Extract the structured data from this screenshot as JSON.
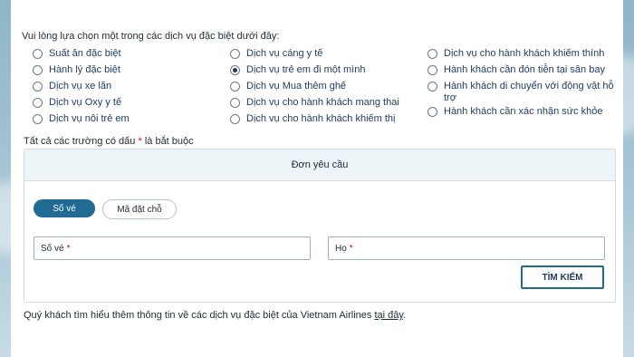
{
  "intro": "Vui lòng lựa chọn một trong các dịch vụ đặc biệt dưới đây:",
  "services": {
    "col1": [
      {
        "label": "Suất ăn đặc biệt",
        "selected": false
      },
      {
        "label": "Hành lý đặc biệt",
        "selected": false
      },
      {
        "label": "Dịch vụ xe lăn",
        "selected": false
      },
      {
        "label": "Dịch vụ Oxy y tế",
        "selected": false
      },
      {
        "label": "Dịch vụ nôi trẻ em",
        "selected": false
      }
    ],
    "col2": [
      {
        "label": "Dịch vụ cáng y tế",
        "selected": false
      },
      {
        "label": "Dịch vụ trẻ em đi một mình",
        "selected": true
      },
      {
        "label": "Dịch vụ Mua thêm ghế",
        "selected": false
      },
      {
        "label": "Dịch vụ cho hành khách mang thai",
        "selected": false
      },
      {
        "label": "Dịch vụ cho hành khách khiếm thị",
        "selected": false
      }
    ],
    "col3": [
      {
        "label": "Dịch vụ cho hành khách khiếm thính",
        "selected": false
      },
      {
        "label": "Hành khách cần đón tiễn tại sân bay",
        "selected": false
      },
      {
        "label": "Hành khách di chuyển với động vật hỗ trợ",
        "selected": false
      },
      {
        "label": "Hành khách cần xác nhận sức khỏe",
        "selected": false
      }
    ]
  },
  "required_note": {
    "text": "Tất cả các trường có dấu",
    "star": "*",
    "suffix": "là bắt buộc"
  },
  "panel": {
    "title": "Đơn yêu cầu",
    "tabs": {
      "active": "Số vé",
      "inactive": "Mã đặt chỗ"
    },
    "fields": {
      "ticket": "Số vé",
      "lastname": "Họ",
      "star": "*"
    },
    "search_button": "TÌM KIẾM"
  },
  "footer": {
    "text": "Quý khách tìm hiểu thêm thông tin về các dịch vụ đặc biệt của Vietnam Airlines",
    "link": "tại đây",
    "end": "."
  }
}
